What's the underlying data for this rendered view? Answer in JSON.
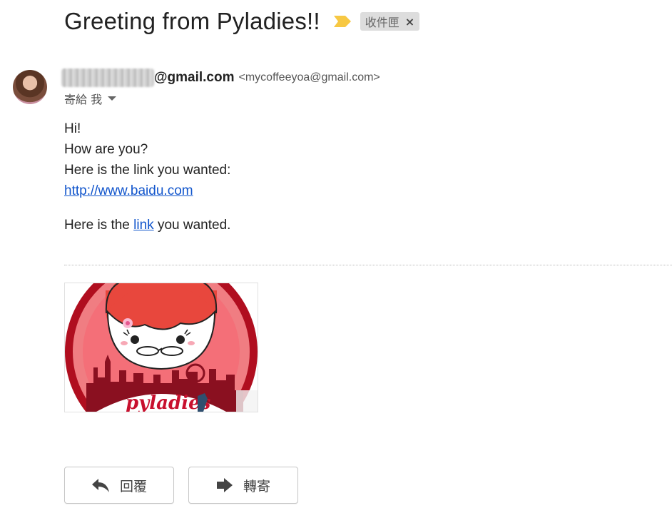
{
  "email": {
    "subject": "Greeting from Pyladies!!",
    "label_chip": "收件匣",
    "label_remove": "×",
    "sender_domain": "@gmail.com",
    "sender_email": "<mycoffeeyoa@gmail.com>",
    "to_line": "寄給 我",
    "body": {
      "line1": "Hi!",
      "line2": "How are you?",
      "line3": "Here is the link you wanted:",
      "url": "http://www.baidu.com",
      "para2_before": "Here is the ",
      "para2_link": "link",
      "para2_after": " you wanted."
    },
    "attachment": {
      "logo_text": "pyladies"
    }
  },
  "actions": {
    "reply_label": "回覆",
    "forward_label": "轉寄"
  },
  "colors": {
    "importance": "#f7c843",
    "link": "#1155cc",
    "pyladies_red": "#c8102e"
  },
  "icons": {
    "importance": "importance-marker-icon",
    "reply": "reply-arrow-icon",
    "forward": "forward-arrow-icon",
    "caret": "chevron-down-icon"
  }
}
